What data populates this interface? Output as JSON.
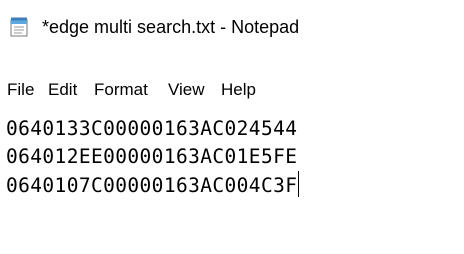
{
  "window": {
    "title": "*edge multi search.txt - Notepad",
    "app_icon": "notepad-icon"
  },
  "menu": {
    "items": [
      {
        "label": "File"
      },
      {
        "label": "Edit"
      },
      {
        "label": "Format"
      },
      {
        "label": "View"
      },
      {
        "label": "Help"
      }
    ]
  },
  "editor": {
    "lines": [
      "0640133C00000163AC024544",
      "064012EE00000163AC01E5FE",
      "0640107C00000163AC004C3F"
    ]
  },
  "colors": {
    "background": "#ffffff",
    "text": "#000000",
    "icon_blue": "#5aa9e0"
  }
}
